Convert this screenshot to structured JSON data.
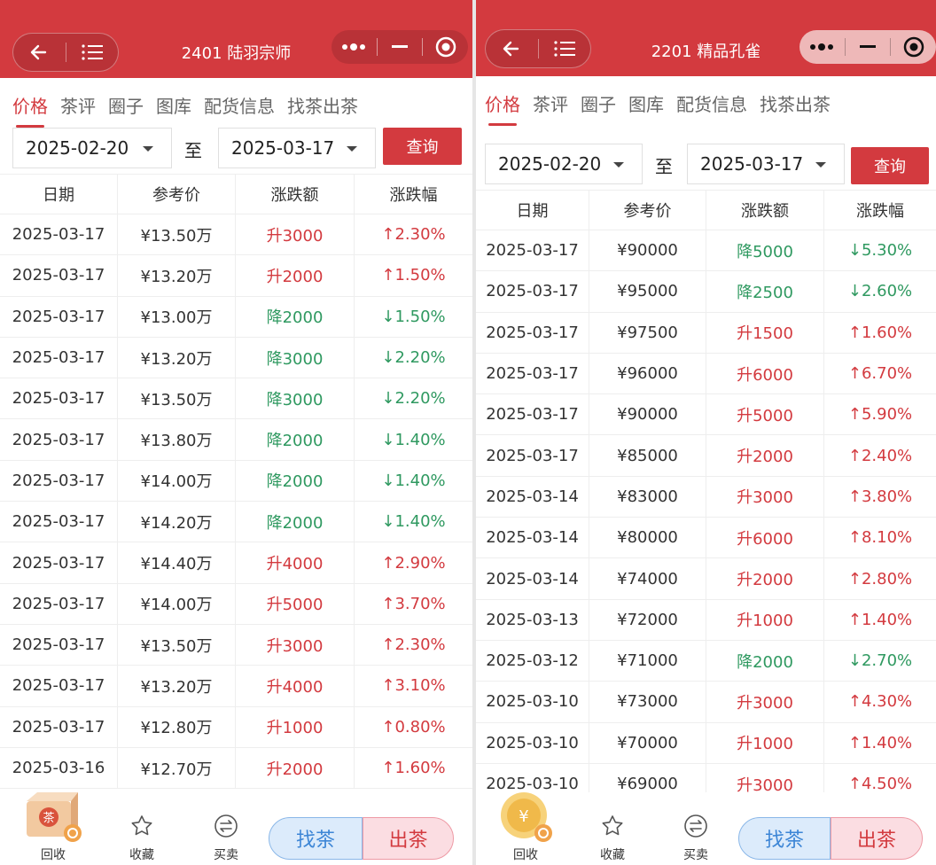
{
  "colors": {
    "brand": "#d33a3f",
    "up": "#d33a3f",
    "down": "#2f9960",
    "find_bg": "#dcebfb",
    "sell_bg": "#fbdde2"
  },
  "panels": [
    {
      "title": "2401 陆羽宗师",
      "tabs": [
        "价格",
        "茶评",
        "圈子",
        "图库",
        "配货信息",
        "找茶出茶"
      ],
      "active_tab": 0,
      "date_from": "2025-02-20",
      "to_label": "至",
      "date_to": "2025-03-17",
      "query_label": "查询",
      "columns": [
        "日期",
        "参考价",
        "涨跌额",
        "涨跌幅"
      ],
      "rows": [
        {
          "date": "2025-03-17",
          "price": "¥13.50万",
          "change": "升3000",
          "pct": "↑2.30%",
          "dir": "up"
        },
        {
          "date": "2025-03-17",
          "price": "¥13.20万",
          "change": "升2000",
          "pct": "↑1.50%",
          "dir": "up"
        },
        {
          "date": "2025-03-17",
          "price": "¥13.00万",
          "change": "降2000",
          "pct": "↓1.50%",
          "dir": "down"
        },
        {
          "date": "2025-03-17",
          "price": "¥13.20万",
          "change": "降3000",
          "pct": "↓2.20%",
          "dir": "down"
        },
        {
          "date": "2025-03-17",
          "price": "¥13.50万",
          "change": "降3000",
          "pct": "↓2.20%",
          "dir": "down"
        },
        {
          "date": "2025-03-17",
          "price": "¥13.80万",
          "change": "降2000",
          "pct": "↓1.40%",
          "dir": "down"
        },
        {
          "date": "2025-03-17",
          "price": "¥14.00万",
          "change": "降2000",
          "pct": "↓1.40%",
          "dir": "down"
        },
        {
          "date": "2025-03-17",
          "price": "¥14.20万",
          "change": "降2000",
          "pct": "↓1.40%",
          "dir": "down"
        },
        {
          "date": "2025-03-17",
          "price": "¥14.40万",
          "change": "升4000",
          "pct": "↑2.90%",
          "dir": "up"
        },
        {
          "date": "2025-03-17",
          "price": "¥14.00万",
          "change": "升5000",
          "pct": "↑3.70%",
          "dir": "up"
        },
        {
          "date": "2025-03-17",
          "price": "¥13.50万",
          "change": "升3000",
          "pct": "↑2.30%",
          "dir": "up"
        },
        {
          "date": "2025-03-17",
          "price": "¥13.20万",
          "change": "升4000",
          "pct": "↑3.10%",
          "dir": "up"
        },
        {
          "date": "2025-03-17",
          "price": "¥12.80万",
          "change": "升1000",
          "pct": "↑0.80%",
          "dir": "up"
        },
        {
          "date": "2025-03-16",
          "price": "¥12.70万",
          "change": "升2000",
          "pct": "↑1.60%",
          "dir": "up"
        }
      ],
      "bottom": {
        "recycle": "回收",
        "favorite": "收藏",
        "trade": "买卖",
        "find": "找茶",
        "sell": "出茶",
        "stamp": "茶"
      }
    },
    {
      "title": "2201 精品孔雀",
      "tabs": [
        "价格",
        "茶评",
        "圈子",
        "图库",
        "配货信息",
        "找茶出茶"
      ],
      "active_tab": 0,
      "date_from": "2025-02-20",
      "to_label": "至",
      "date_to": "2025-03-17",
      "query_label": "查询",
      "columns": [
        "日期",
        "参考价",
        "涨跌额",
        "涨跌幅"
      ],
      "rows": [
        {
          "date": "2025-03-17",
          "price": "¥90000",
          "change": "降5000",
          "pct": "↓5.30%",
          "dir": "down"
        },
        {
          "date": "2025-03-17",
          "price": "¥95000",
          "change": "降2500",
          "pct": "↓2.60%",
          "dir": "down"
        },
        {
          "date": "2025-03-17",
          "price": "¥97500",
          "change": "升1500",
          "pct": "↑1.60%",
          "dir": "up"
        },
        {
          "date": "2025-03-17",
          "price": "¥96000",
          "change": "升6000",
          "pct": "↑6.70%",
          "dir": "up"
        },
        {
          "date": "2025-03-17",
          "price": "¥90000",
          "change": "升5000",
          "pct": "↑5.90%",
          "dir": "up"
        },
        {
          "date": "2025-03-17",
          "price": "¥85000",
          "change": "升2000",
          "pct": "↑2.40%",
          "dir": "up"
        },
        {
          "date": "2025-03-14",
          "price": "¥83000",
          "change": "升3000",
          "pct": "↑3.80%",
          "dir": "up"
        },
        {
          "date": "2025-03-14",
          "price": "¥80000",
          "change": "升6000",
          "pct": "↑8.10%",
          "dir": "up"
        },
        {
          "date": "2025-03-14",
          "price": "¥74000",
          "change": "升2000",
          "pct": "↑2.80%",
          "dir": "up"
        },
        {
          "date": "2025-03-13",
          "price": "¥72000",
          "change": "升1000",
          "pct": "↑1.40%",
          "dir": "up"
        },
        {
          "date": "2025-03-12",
          "price": "¥71000",
          "change": "降2000",
          "pct": "↓2.70%",
          "dir": "down"
        },
        {
          "date": "2025-03-10",
          "price": "¥73000",
          "change": "升3000",
          "pct": "↑4.30%",
          "dir": "up"
        },
        {
          "date": "2025-03-10",
          "price": "¥70000",
          "change": "升1000",
          "pct": "↑1.40%",
          "dir": "up"
        },
        {
          "date": "2025-03-10",
          "price": "¥69000",
          "change": "升3000",
          "pct": "↑4.50%",
          "dir": "up"
        }
      ],
      "bottom": {
        "recycle": "回收",
        "favorite": "收藏",
        "trade": "买卖",
        "find": "找茶",
        "sell": "出茶",
        "stamp": "¥"
      }
    }
  ]
}
